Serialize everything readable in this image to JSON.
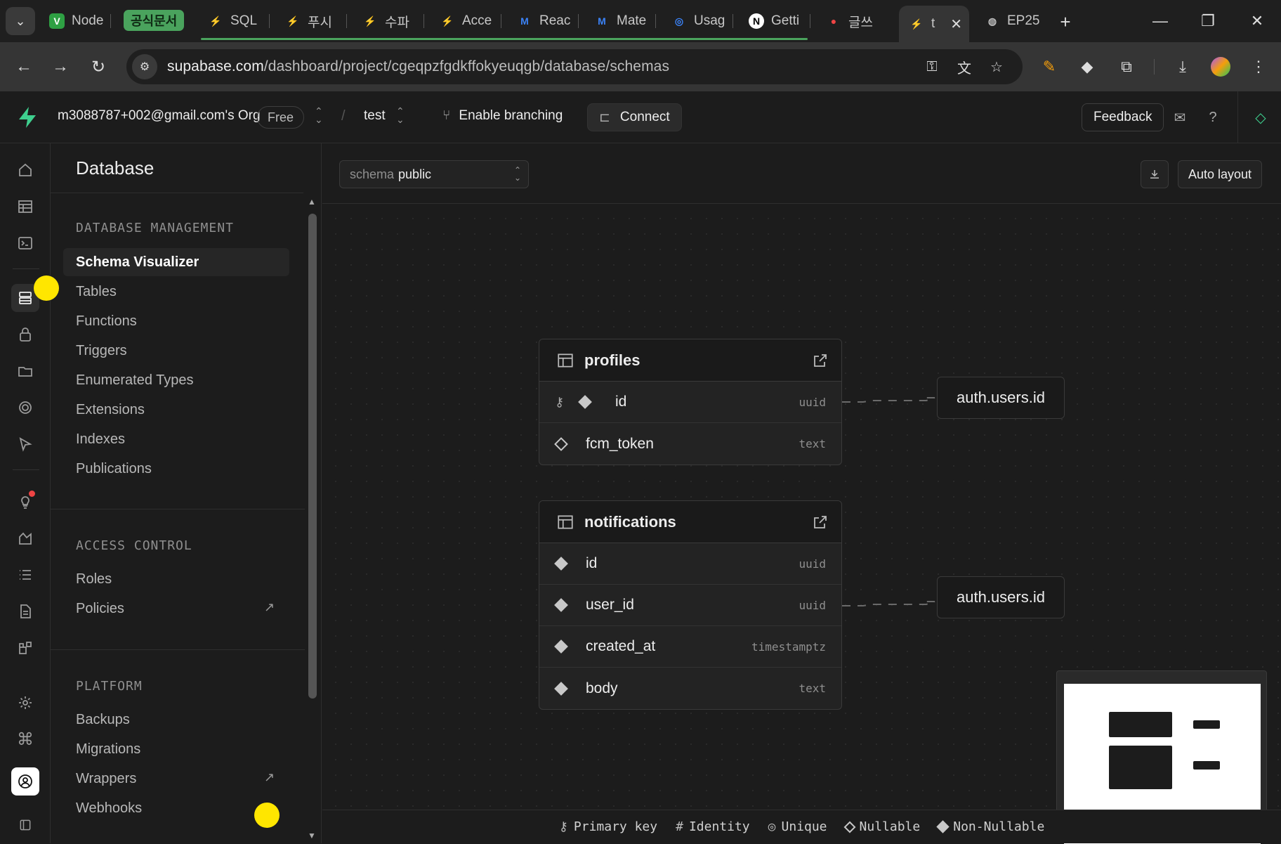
{
  "browser": {
    "tabs": [
      {
        "label": "Node",
        "fav": "V",
        "fav_color": "#3fb950"
      },
      {
        "label": "SQL",
        "fav": "⚡",
        "fav_color": "#3ecf8e"
      },
      {
        "label": "푸시",
        "fav": "⚡",
        "fav_color": "#ffffff"
      },
      {
        "label": "수파",
        "fav": "⚡",
        "fav_color": "#3ecf8e"
      },
      {
        "label": "Acce",
        "fav": "⚡",
        "fav_color": "#3ecf8e"
      },
      {
        "label": "Reac",
        "fav": "M",
        "fav_color": "#3b82f6"
      },
      {
        "label": "Mate",
        "fav": "M",
        "fav_color": "#3b82f6"
      },
      {
        "label": "Usag",
        "fav": "◎",
        "fav_color": "#3b82f6"
      },
      {
        "label": "Getti",
        "fav": "N",
        "fav_color": "#ffffff"
      },
      {
        "label": "글쓰",
        "fav": "●",
        "fav_color": "#ef4444"
      },
      {
        "label": "t",
        "fav": "⚡",
        "fav_color": "#3ecf8e"
      },
      {
        "label": "EP25",
        "fav": "◍",
        "fav_color": "#bbbbbb"
      }
    ],
    "tab_group_label": "공식문서",
    "url_host": "supabase.com",
    "url_path": "/dashboard/project/cgeqpzfgdkffokyeuqgb/database/schemas"
  },
  "topbar": {
    "org": "m3088787+002@gmail.com's Org",
    "plan": "Free",
    "project": "test",
    "branching": "Enable branching",
    "connect": "Connect",
    "feedback": "Feedback"
  },
  "sidebar": {
    "title": "Database",
    "sections": [
      {
        "label": "DATABASE MANAGEMENT",
        "items": [
          "Schema Visualizer",
          "Tables",
          "Functions",
          "Triggers",
          "Enumerated Types",
          "Extensions",
          "Indexes",
          "Publications"
        ]
      },
      {
        "label": "ACCESS CONTROL",
        "items": [
          "Roles",
          "Policies"
        ]
      },
      {
        "label": "PLATFORM",
        "items": [
          "Backups",
          "Migrations",
          "Wrappers",
          "Webhooks"
        ]
      }
    ]
  },
  "main": {
    "schema_label": "schema",
    "schema_value": "public",
    "auto_layout": "Auto layout",
    "tables": [
      {
        "name": "profiles",
        "columns": [
          {
            "name": "id",
            "type": "uuid",
            "pk": true,
            "nullable": false
          },
          {
            "name": "fcm_token",
            "type": "text",
            "pk": false,
            "nullable": true
          }
        ]
      },
      {
        "name": "notifications",
        "columns": [
          {
            "name": "id",
            "type": "uuid",
            "pk": false,
            "nullable": false
          },
          {
            "name": "user_id",
            "type": "uuid",
            "pk": false,
            "nullable": false
          },
          {
            "name": "created_at",
            "type": "timestamptz",
            "pk": false,
            "nullable": false
          },
          {
            "name": "body",
            "type": "text",
            "pk": false,
            "nullable": false
          }
        ]
      }
    ],
    "references": [
      "auth.users.id",
      "auth.users.id"
    ],
    "legend": [
      "Primary key",
      "Identity",
      "Unique",
      "Nullable",
      "Non-Nullable"
    ]
  },
  "colors": {
    "brand": "#3ecf8e",
    "cursor_highlight": "#ffe600"
  }
}
